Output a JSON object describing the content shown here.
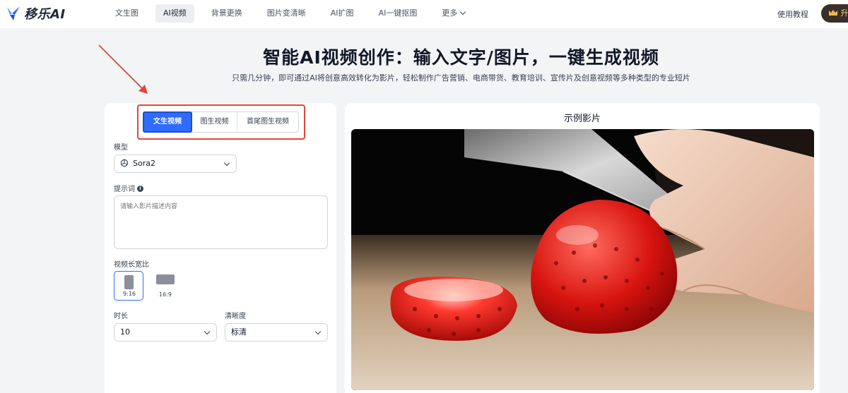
{
  "brand": {
    "name": "移乐AI"
  },
  "nav": {
    "items": [
      {
        "label": "文生图"
      },
      {
        "label": "AI视频"
      },
      {
        "label": "背景更换"
      },
      {
        "label": "图片变清晰"
      },
      {
        "label": "AI扩图"
      },
      {
        "label": "AI一键抠图"
      },
      {
        "label": "更多"
      }
    ],
    "active_index": 1,
    "help_label": "使用教程",
    "pro_label": "升"
  },
  "hero": {
    "title": "智能AI视频创作：输入文字/图片，一键生成视频",
    "subtitle": "只需几分钟，即可通过AI将创意高效转化为影片，轻松制作广告营销、电商带货、教育培训、宣传片及创意视频等多种类型的专业短片"
  },
  "form": {
    "mode_tabs": [
      {
        "label": "文生视频"
      },
      {
        "label": "图生视频"
      },
      {
        "label": "首尾图生视频"
      }
    ],
    "model_label": "模型",
    "model_value": "Sora2",
    "prompt_label": "提示词",
    "prompt_placeholder": "请输入影片描述内容",
    "ratio_label": "视频长宽比",
    "ratios": [
      {
        "label": "9:16",
        "selected": true
      },
      {
        "label": "16:9",
        "selected": false
      }
    ],
    "duration_label": "时长",
    "duration_value": "10",
    "quality_label": "清晰度",
    "quality_value": "标清"
  },
  "preview": {
    "title": "示例影片"
  },
  "colors": {
    "accent": "#2f6bff",
    "annotation": "#e0473a",
    "pro_bg": "#3b3028",
    "pro_text": "#f5d38b"
  }
}
